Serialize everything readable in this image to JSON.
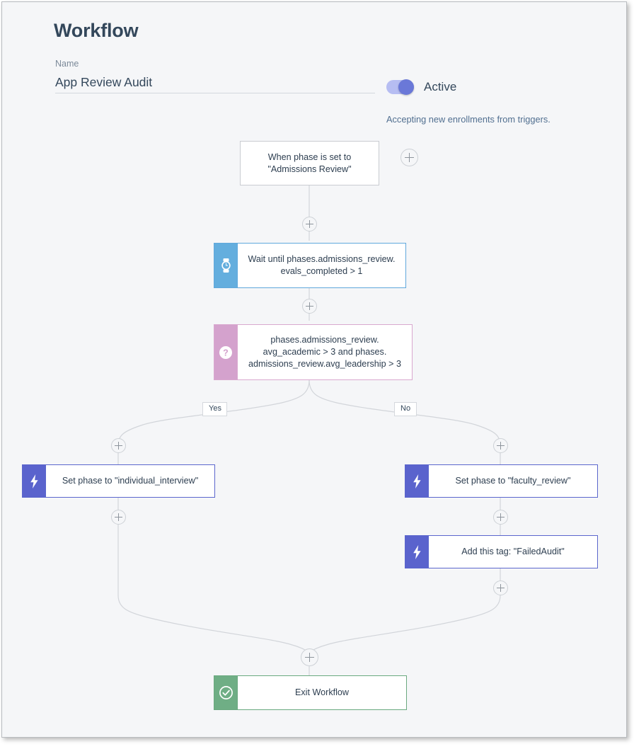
{
  "window": {
    "title": "Workflow"
  },
  "form": {
    "name_label": "Name",
    "name_value": "App Review Audit",
    "name_placeholder": "Workflow name"
  },
  "status": {
    "toggle_label": "Active",
    "toggle_state": "on",
    "help_text": "Accepting new enrollments from triggers.",
    "toggle_on_color": "#6a78d8",
    "toggle_track_color": "#b6bdf2"
  },
  "canvas": {
    "branch_labels": {
      "yes": "Yes",
      "no": "No"
    },
    "add_button_label": "+",
    "nodes": [
      {
        "id": "trigger",
        "type": "trigger",
        "icon": "none",
        "text": "When phase is set to \"Admissions Review\"",
        "accent_color": "#ffffff",
        "border_color": "#c9ccd1"
      },
      {
        "id": "delay",
        "type": "delay",
        "icon": "watch-icon",
        "text": "Wait until phases.admissions_review. evals_completed > 1",
        "accent_color": "#64aede",
        "border_color": "#60a8dc"
      },
      {
        "id": "branch",
        "type": "branch",
        "icon": "question-mark-icon",
        "text": "phases.admissions_review. avg_academic > 3 and phases. admissions_review.avg_leadership > 3",
        "accent_color": "#d4a2cd",
        "border_color": "#d9a8cf"
      },
      {
        "id": "action-yes",
        "type": "action",
        "icon": "lightning-bolt-icon",
        "text": "Set phase to \"individual_interview\"",
        "accent_color": "#5a63cd",
        "border_color": "#5b66cd"
      },
      {
        "id": "action-no-1",
        "type": "action",
        "icon": "lightning-bolt-icon",
        "text": "Set phase to \"faculty_review\"",
        "accent_color": "#5a63cd",
        "border_color": "#5b66cd"
      },
      {
        "id": "action-no-2",
        "type": "action",
        "icon": "lightning-bolt-icon",
        "text": "Add this tag: \"FailedAudit\"",
        "accent_color": "#5a63cd",
        "border_color": "#5b66cd"
      },
      {
        "id": "exit",
        "type": "exit",
        "icon": "check-circle-icon",
        "text": "Exit Workflow",
        "accent_color": "#6fae85",
        "border_color": "#6aa97f"
      }
    ]
  }
}
